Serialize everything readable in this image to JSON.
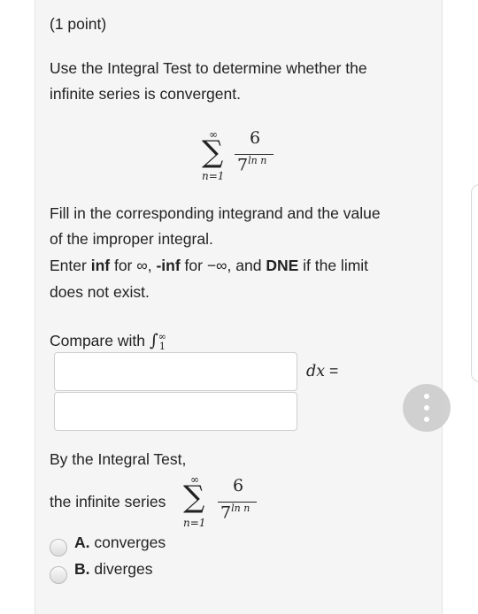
{
  "points": "(1 point)",
  "intro": [
    "Use the Integral Test to determine whether the",
    "infinite series is convergent."
  ],
  "series": {
    "sigma": "∑",
    "upper": "∞",
    "lower": "n=1",
    "numerator": "6",
    "den_base": "7",
    "den_exp": "ln n"
  },
  "instructions": [
    "Fill in the corresponding integrand and the value",
    "of the improper integral.",
    "does not exist."
  ],
  "enter_line": {
    "p1": "Enter ",
    "inf": "inf",
    "p2": " for ∞, ",
    "neginf": "-inf",
    "p3": " for −∞, and ",
    "dne": "DNE",
    "p4": " if the limit"
  },
  "compare": {
    "label": "Compare with ",
    "integral": "∫",
    "lower": "1",
    "upper": "∞",
    "dx": "dx",
    "equals": " ="
  },
  "inputs": {
    "integrand_value": "",
    "integral_value": ""
  },
  "by_test": "By the Integral Test,",
  "conclusion": "the infinite series",
  "options": [
    {
      "letter": "A.",
      "text": "converges"
    },
    {
      "letter": "B.",
      "text": "diverges"
    }
  ]
}
